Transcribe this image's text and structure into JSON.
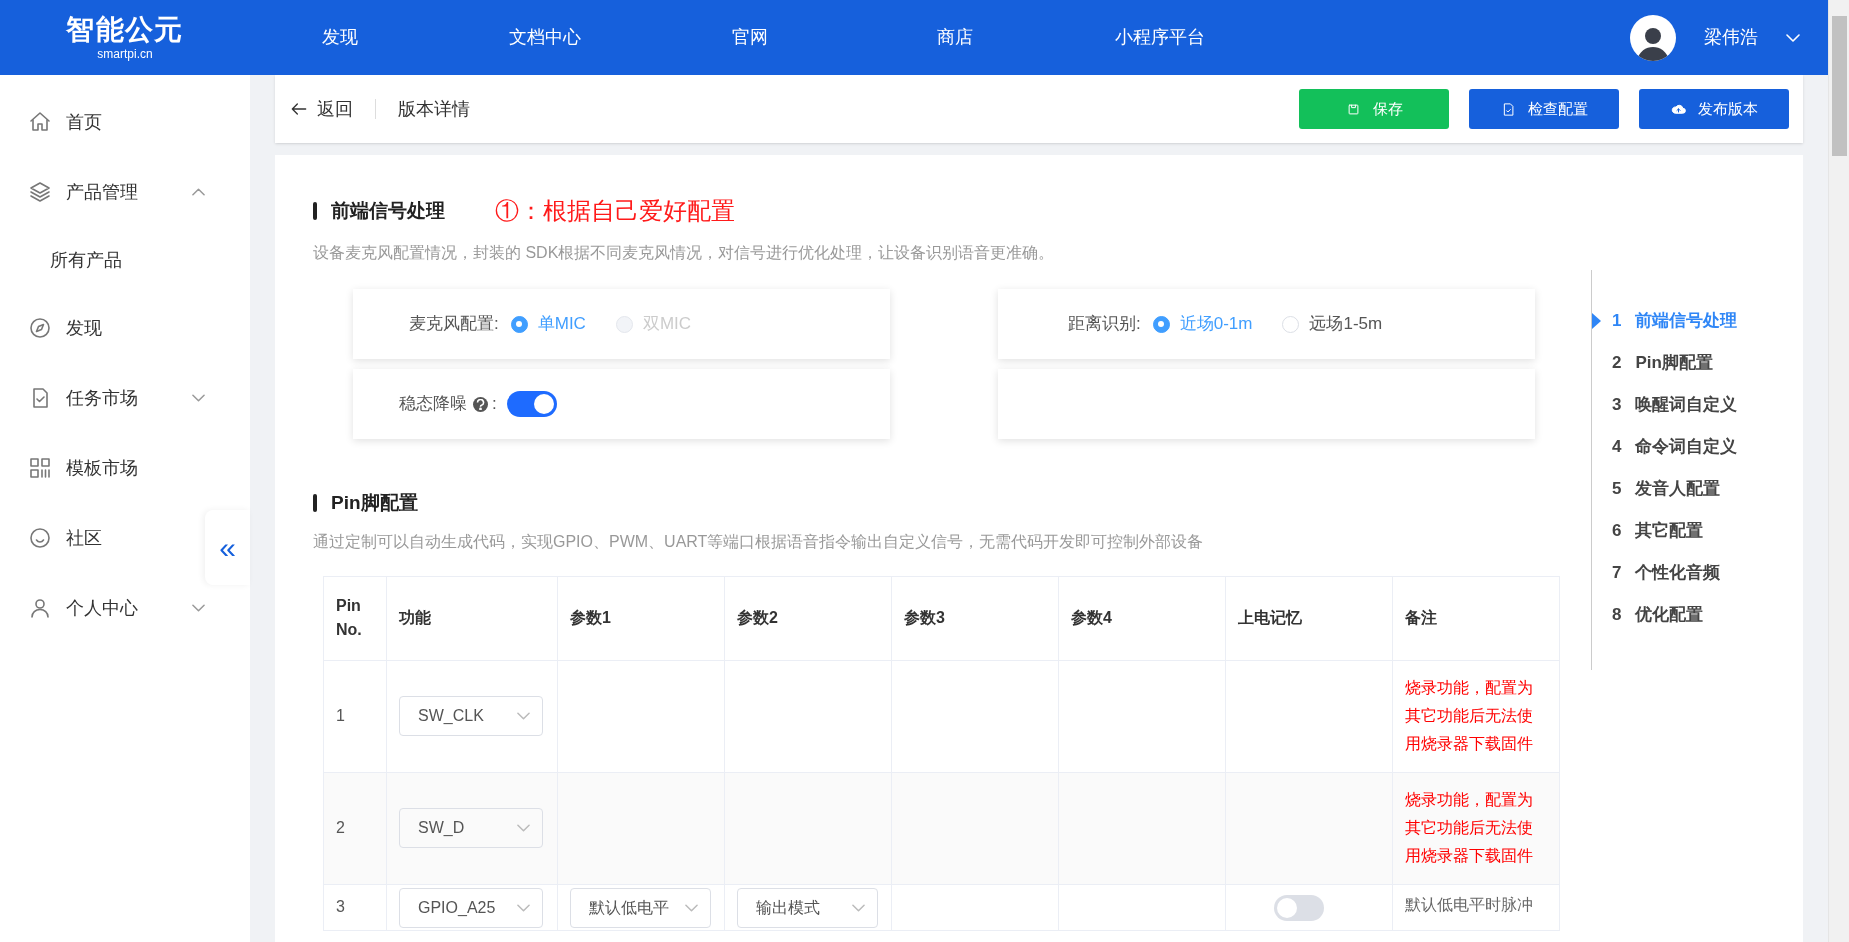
{
  "header": {
    "logo": {
      "title": "智能公元",
      "subtitle": "smartpi.cn"
    },
    "nav": [
      {
        "label": "发现"
      },
      {
        "label": "文档中心"
      },
      {
        "label": "官网"
      },
      {
        "label": "商店"
      },
      {
        "label": "小程序平台"
      }
    ],
    "user": {
      "name": "梁伟浩"
    }
  },
  "sidebar": {
    "items": [
      {
        "label": "首页"
      },
      {
        "label": "产品管理",
        "expanded": true,
        "children": [
          {
            "label": "所有产品"
          }
        ]
      },
      {
        "label": "发现"
      },
      {
        "label": "任务市场",
        "expanded": false
      },
      {
        "label": "模板市场"
      },
      {
        "label": "社区"
      },
      {
        "label": "个人中心",
        "expanded": false
      }
    ],
    "collapse_button": "«"
  },
  "toolbar": {
    "back": "返回",
    "title": "版本详情",
    "buttons": [
      {
        "label": "保存",
        "kind": "save"
      },
      {
        "label": "检查配置",
        "kind": "check"
      },
      {
        "label": "发布版本",
        "kind": "publish"
      }
    ]
  },
  "sections": [
    {
      "title": "前端信号处理",
      "annotation": "①：根据自己爱好配置",
      "description": "设备麦克风配置情况，封装的 SDK根据不同麦克风情况，对信号进行优化处理，让设备识别语音更准确。",
      "cards": [
        {
          "kind": "radio",
          "label": "麦克风配置:",
          "options": [
            {
              "label": "单MIC",
              "selected": true,
              "disabled": false
            },
            {
              "label": "双MIC",
              "selected": false,
              "disabled": true
            }
          ]
        },
        {
          "kind": "radio",
          "label": "距离识别:",
          "options": [
            {
              "label": "近场0-1m",
              "selected": true,
              "disabled": false
            },
            {
              "label": "远场1-5m",
              "selected": false,
              "disabled": false
            }
          ]
        },
        {
          "kind": "switch",
          "label": "稳态降噪",
          "colon": ":",
          "on": true
        },
        {
          "kind": "empty"
        }
      ]
    },
    {
      "title": "Pin脚配置",
      "description": "通过定制可以自动生成代码，实现GPIO、PWM、UART等端口根据语音指令输出自定义信号，无需代码开发即可控制外部设备",
      "table": {
        "columns": [
          "Pin No.",
          "功能",
          "参数1",
          "参数2",
          "参数3",
          "参数4",
          "上电记忆",
          "备注"
        ],
        "rows": [
          {
            "pin": "1",
            "function": "SW_CLK",
            "param1": null,
            "param2": null,
            "memory": null,
            "note": "烧录功能，配置为其它功能后无法使用烧录器下载固件",
            "note_warning": true
          },
          {
            "pin": "2",
            "function": "SW_D",
            "param1": null,
            "param2": null,
            "memory": null,
            "note": "烧录功能，配置为其它功能后无法使用烧录器下载固件",
            "note_warning": true
          },
          {
            "pin": "3",
            "function": "GPIO_A25",
            "param1": "默认低电平",
            "param2": "输出模式",
            "memory": {
              "on": false
            },
            "note": "默认低电平时脉冲",
            "note_warning": false
          }
        ]
      }
    }
  ],
  "anchor_nav": [
    {
      "number": "1",
      "label": "前端信号处理",
      "selected": true
    },
    {
      "number": "2",
      "label": "Pin脚配置",
      "selected": false
    },
    {
      "number": "3",
      "label": "唤醒词自定义",
      "selected": false
    },
    {
      "number": "4",
      "label": "命令词自定义",
      "selected": false
    },
    {
      "number": "5",
      "label": "发音人配置",
      "selected": false
    },
    {
      "number": "6",
      "label": "其它配置",
      "selected": false
    },
    {
      "number": "7",
      "label": "个性化音频",
      "selected": false
    },
    {
      "number": "8",
      "label": "优化配置",
      "selected": false
    }
  ]
}
